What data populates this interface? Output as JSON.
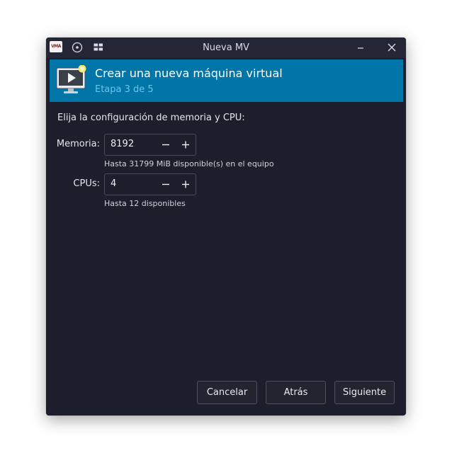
{
  "window": {
    "title": "Nueva MV",
    "app_icon_text": "VMA"
  },
  "banner": {
    "title": "Crear una nueva máquina virtual",
    "step": "Etapa 3 de 5"
  },
  "form": {
    "prompt": "Elija la configuración de memoria y CPU:",
    "memory": {
      "label": "Memoria:",
      "value": "8192",
      "hint": "Hasta 31799 MiB disponible(s) en el equipo"
    },
    "cpus": {
      "label": "CPUs:",
      "value": "4",
      "hint": "Hasta 12 disponibles"
    }
  },
  "buttons": {
    "cancel": "Cancelar",
    "back": "Atrás",
    "next": "Siguiente"
  },
  "colors": {
    "banner": "#0075a8",
    "window_bg": "#1c1f2b",
    "titlebar": "#232634"
  }
}
